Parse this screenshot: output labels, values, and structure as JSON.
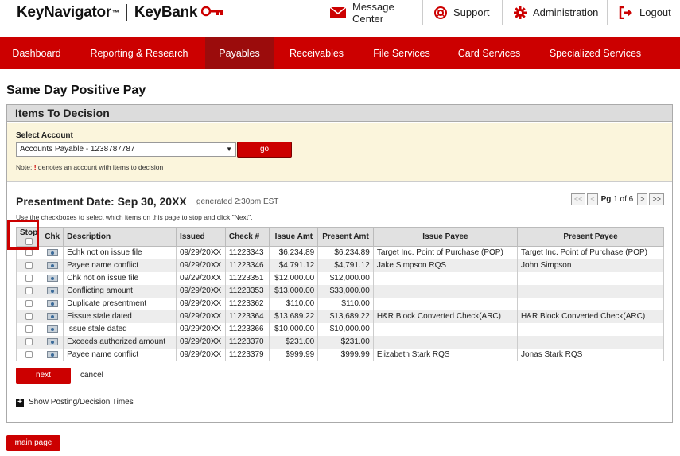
{
  "brand": {
    "product": "KeyNavigator",
    "trademark": "™",
    "bank": "KeyBank"
  },
  "toplinks": [
    {
      "label": "Message Center",
      "icon": "envelope-icon"
    },
    {
      "label": "Support",
      "icon": "lifebuoy-icon"
    },
    {
      "label": "Administration",
      "icon": "gear-icon"
    },
    {
      "label": "Logout",
      "icon": "logout-icon"
    }
  ],
  "nav": [
    {
      "label": "Dashboard"
    },
    {
      "label": "Reporting & Research"
    },
    {
      "label": "Payables",
      "active": true
    },
    {
      "label": "Receivables"
    },
    {
      "label": "File Services"
    },
    {
      "label": "Card Services"
    },
    {
      "label": "Specialized Services"
    }
  ],
  "page": {
    "title": "Same Day Positive Pay"
  },
  "panel": {
    "title": "Items To Decision"
  },
  "account": {
    "label": "Select Account",
    "selected": "Accounts Payable - 1238787787",
    "go_label": "go",
    "note_prefix": "Note: ",
    "note_excl": "!",
    "note_suffix": " denotes an account with items to decision"
  },
  "presentment": {
    "title": "Presentment Date: Sep 30, 20XX",
    "generated": "generated 2:30pm EST",
    "instructions": "Use the checkboxes to select which items on this page to stop and click \"Next\"."
  },
  "pager": {
    "first": "<<",
    "prev": "<",
    "pg_label": "Pg",
    "current": "1",
    "of_label": "of",
    "total": "6",
    "next": ">",
    "last": ">>"
  },
  "table": {
    "headers": {
      "stop": "Stop",
      "chk": "Chk",
      "description": "Description",
      "issued": "Issued",
      "check_no": "Check #",
      "issue_amt": "Issue Amt",
      "present_amt": "Present Amt",
      "issue_payee": "Issue Payee",
      "present_payee": "Present Payee"
    },
    "rows": [
      {
        "description": "Echk not on issue file",
        "issued": "09/29/20XX",
        "check_no": "11223343",
        "issue_amt": "$6,234.89",
        "present_amt": "$6,234.89",
        "issue_payee": "Target Inc. Point of Purchase (POP)",
        "present_payee": "Target Inc. Point of Purchase (POP)"
      },
      {
        "description": "Payee name conflict",
        "issued": "09/29/20XX",
        "check_no": "11223346",
        "issue_amt": "$4,791.12",
        "present_amt": "$4,791.12",
        "issue_payee": "Jake Simpson RQS",
        "present_payee": "John Simpson"
      },
      {
        "description": "Chk not on issue file",
        "issued": "09/29/20XX",
        "check_no": "11223351",
        "issue_amt": "$12,000.00",
        "present_amt": "$12,000.00",
        "issue_payee": "",
        "present_payee": ""
      },
      {
        "description": "Conflicting amount",
        "issued": "09/29/20XX",
        "check_no": "11223353",
        "issue_amt": "$13,000.00",
        "present_amt": "$33,000.00",
        "issue_payee": "",
        "present_payee": ""
      },
      {
        "description": "Duplicate presentment",
        "issued": "09/29/20XX",
        "check_no": "11223362",
        "issue_amt": "$110.00",
        "present_amt": "$110.00",
        "issue_payee": "",
        "present_payee": ""
      },
      {
        "description": "Eissue stale dated",
        "issued": "09/29/20XX",
        "check_no": "11223364",
        "issue_amt": "$13,689.22",
        "present_amt": "$13,689.22",
        "issue_payee": "H&R Block Converted Check(ARC)",
        "present_payee": "H&R Block Converted Check(ARC)"
      },
      {
        "description": "Issue stale dated",
        "issued": "09/29/20XX",
        "check_no": "11223366",
        "issue_amt": "$10,000.00",
        "present_amt": "$10,000.00",
        "issue_payee": "",
        "present_payee": ""
      },
      {
        "description": "Exceeds authorized amount",
        "issued": "09/29/20XX",
        "check_no": "11223370",
        "issue_amt": "$231.00",
        "present_amt": "$231.00",
        "issue_payee": "",
        "present_payee": ""
      },
      {
        "description": "Payee name conflict",
        "issued": "09/29/20XX",
        "check_no": "11223379",
        "issue_amt": "$999.99",
        "present_amt": "$999.99",
        "issue_payee": "Elizabeth Stark RQS",
        "present_payee": "Jonas Stark RQS"
      }
    ]
  },
  "actions": {
    "next": "next",
    "cancel": "cancel",
    "show_times": "Show Posting/Decision Times",
    "main_page": "main page"
  },
  "colors": {
    "brand_red": "#cc0000",
    "nav_active": "#9b0c0c",
    "panel_bg": "#fbf5dc"
  }
}
